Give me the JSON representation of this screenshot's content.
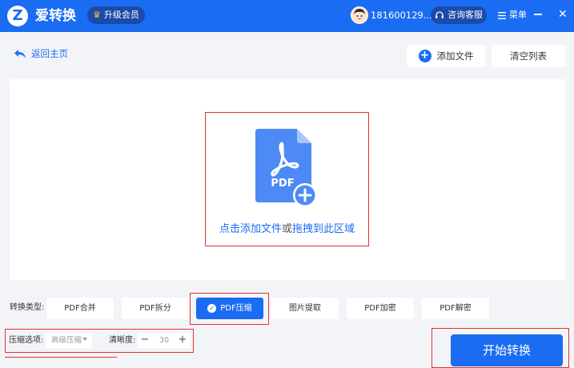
{
  "header": {
    "logo_glyph": "Z",
    "app_name": "爱转换",
    "vip_label": "升级会员",
    "username": "181600129...",
    "service_label": "咨询客服",
    "menu_label": "菜单",
    "close_glyph": "✕"
  },
  "toolbar": {
    "back_label": "返回主页",
    "add_file_label": "添加文件",
    "clear_label": "清空列表"
  },
  "dropzone": {
    "badge_text": "PDF",
    "prompt_before": "点击添加文件",
    "prompt_or": "或",
    "prompt_after": "拖拽到此区域"
  },
  "conversion": {
    "label": "转换类型:",
    "types": [
      {
        "label": "PDF合并",
        "active": false
      },
      {
        "label": "PDF拆分",
        "active": false
      },
      {
        "label": "PDF压缩",
        "active": true
      },
      {
        "label": "图片提取",
        "active": false
      },
      {
        "label": "PDF加密",
        "active": false
      },
      {
        "label": "PDF解密",
        "active": false
      }
    ]
  },
  "options": {
    "compress_label": "压缩选项:",
    "compress_level": "高级压缩",
    "clarity_label": "清晰度:",
    "clarity_value": "30",
    "minus": "−",
    "plus": "+"
  },
  "start_label": "开始转换",
  "colors": {
    "primary": "#1a6cf2",
    "header_pill": "#1b4aa8",
    "highlight_border": "#e0332f",
    "background": "#f3f4f8"
  },
  "icons": [
    "crown-icon",
    "avatar-icon",
    "headset-icon",
    "menu-icon",
    "minimize-icon",
    "close-icon",
    "back-arrow-icon",
    "plus-circle-icon",
    "pdf-file-icon",
    "check-icon",
    "chevron-down-icon"
  ]
}
